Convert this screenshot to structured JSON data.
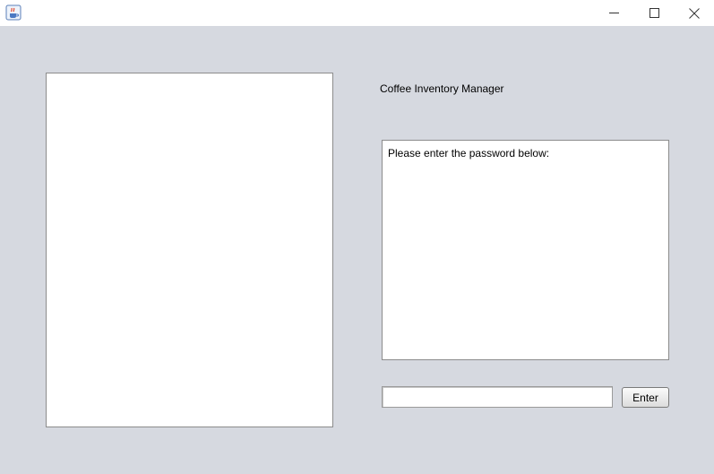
{
  "window": {
    "app_icon": "java-coffee-cup-icon",
    "controls": {
      "minimize_icon": "minimize-icon",
      "maximize_icon": "maximize-icon",
      "close_icon": "close-icon"
    }
  },
  "main": {
    "title": "Coffee Inventory Manager",
    "output_text": "Please enter the password below:",
    "password_value": "",
    "enter_label": "Enter"
  },
  "colors": {
    "background": "#d6d9e0",
    "titlebar": "#ffffff",
    "panel": "#ffffff",
    "border": "#8c8c8c"
  }
}
